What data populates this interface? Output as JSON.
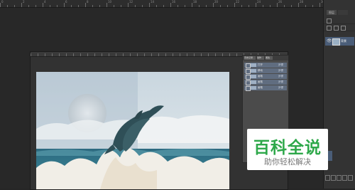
{
  "app": {
    "title": "Photoshop"
  },
  "top_ruler": {
    "labels": [
      "0",
      "2",
      "4",
      "6",
      "8",
      "10",
      "12",
      "14",
      "16",
      "18",
      "20",
      "22",
      "24",
      "26",
      "28",
      "30"
    ]
  },
  "right_dock": {
    "tab_label": "图层",
    "layer_name": "背景",
    "eye_glyph": "👁"
  },
  "actions_panel": {
    "tabs": [
      "历史记录",
      "动作",
      "属性"
    ],
    "rows": [
      {
        "text": "打开",
        "tag": "步骤"
      },
      {
        "text": "移动",
        "tag": "步骤"
      },
      {
        "text": "画笔",
        "tag": "步骤"
      },
      {
        "text": "画笔",
        "tag": "步骤"
      },
      {
        "text": "画笔",
        "tag": "步骤"
      }
    ]
  },
  "canvas": {
    "sky_color": "#cfdbe3",
    "sea_color": "#2e6f85",
    "foam_color": "#f0ede6",
    "dolphin_color": "#2f4f57"
  },
  "watermark": {
    "title": "百科全说",
    "subtitle": "助你轻松解决",
    "title_color": "#2ea84a"
  }
}
